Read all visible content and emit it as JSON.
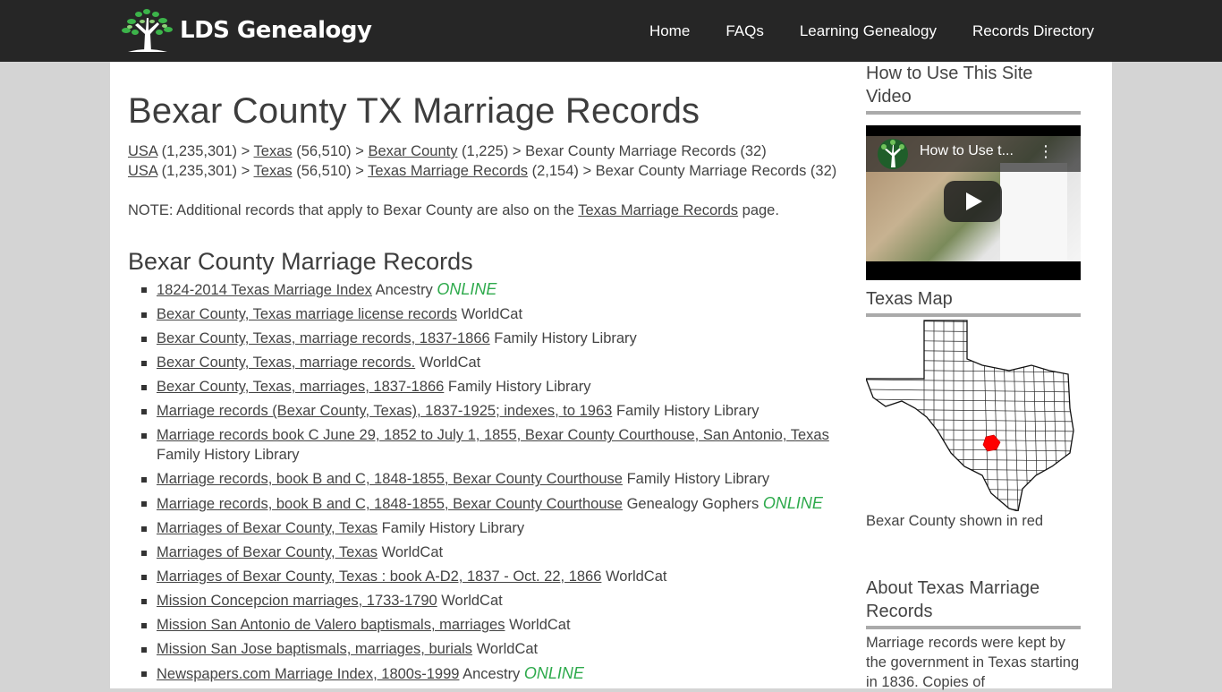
{
  "header": {
    "logo_text": "LDS Genealogy",
    "nav": [
      {
        "label": "Home"
      },
      {
        "label": "FAQs"
      },
      {
        "label": "Learning Genealogy"
      },
      {
        "label": "Records Directory"
      }
    ]
  },
  "main": {
    "title": "Bexar County TX Marriage Records",
    "breadcrumbs": [
      {
        "items": [
          {
            "link": "USA",
            "count": " (1,235,301) > "
          },
          {
            "link": "Texas",
            "count": " (56,510) > "
          },
          {
            "link": "Bexar County",
            "count": " (1,225) > "
          }
        ],
        "current": "Bexar County Marriage Records (32)"
      },
      {
        "items": [
          {
            "link": "USA",
            "count": " (1,235,301) > "
          },
          {
            "link": "Texas",
            "count": " (56,510) > "
          },
          {
            "link": "Texas Marriage Records",
            "count": " (2,154) > "
          }
        ],
        "current": "Bexar County Marriage Records (32)"
      }
    ],
    "note": {
      "prefix": "NOTE: Additional records that apply to Bexar County are also on the ",
      "link": "Texas Marriage Records",
      "suffix": " page."
    },
    "section_title": "Bexar County Marriage Records",
    "online_label": "ONLINE",
    "records": [
      {
        "title": "1824-2014 Texas Marriage Index",
        "source": "Ancestry",
        "online": true
      },
      {
        "title": "Bexar County, Texas marriage license records",
        "source": "WorldCat",
        "online": false
      },
      {
        "title": "Bexar County, Texas, marriage records, 1837-1866",
        "source": "Family History Library",
        "online": false
      },
      {
        "title": "Bexar County, Texas, marriage records.",
        "source": "WorldCat",
        "online": false
      },
      {
        "title": "Bexar County, Texas, marriages, 1837-1866",
        "source": "Family History Library",
        "online": false
      },
      {
        "title": "Marriage records (Bexar County, Texas), 1837-1925; indexes, to 1963",
        "source": "Family History Library",
        "online": false
      },
      {
        "title": "Marriage records book C June 29, 1852 to July 1, 1855, Bexar County Courthouse, San Antonio, Texas",
        "source": "Family History Library",
        "online": false
      },
      {
        "title": "Marriage records, book B and C, 1848-1855, Bexar County Courthouse",
        "source": "Family History Library",
        "online": false
      },
      {
        "title": "Marriage records, book B and C, 1848-1855, Bexar County Courthouse",
        "source": "Genealogy Gophers",
        "online": true
      },
      {
        "title": "Marriages of Bexar County, Texas",
        "source": "Family History Library",
        "online": false
      },
      {
        "title": "Marriages of Bexar County, Texas",
        "source": "WorldCat",
        "online": false
      },
      {
        "title": "Marriages of Bexar County, Texas : book A-D2, 1837 - Oct. 22, 1866",
        "source": "WorldCat",
        "online": false
      },
      {
        "title": "Mission Concepcion marriages, 1733-1790",
        "source": "WorldCat",
        "online": false
      },
      {
        "title": "Mission San Antonio de Valero baptismals, marriages",
        "source": "WorldCat",
        "online": false
      },
      {
        "title": "Mission San Jose baptismals, marriages, burials",
        "source": "WorldCat",
        "online": false
      },
      {
        "title": "Newspapers.com Marriage Index, 1800s-1999",
        "source": "Ancestry",
        "online": true
      }
    ]
  },
  "sidebar": {
    "video_heading": "How to Use This Site Video",
    "video_title": "How to Use t...",
    "map_heading": "Texas Map",
    "map_caption": "Bexar County shown in red",
    "highlight_color": "#ff0000",
    "about_heading": "About Texas Marriage Records",
    "about_text": "Marriage records were kept by the government in Texas starting in 1836. Copies of"
  },
  "colors": {
    "header_bg": "#262626",
    "page_bg": "#d4d4d4",
    "online": "#2eaa4c",
    "text": "#444444"
  }
}
